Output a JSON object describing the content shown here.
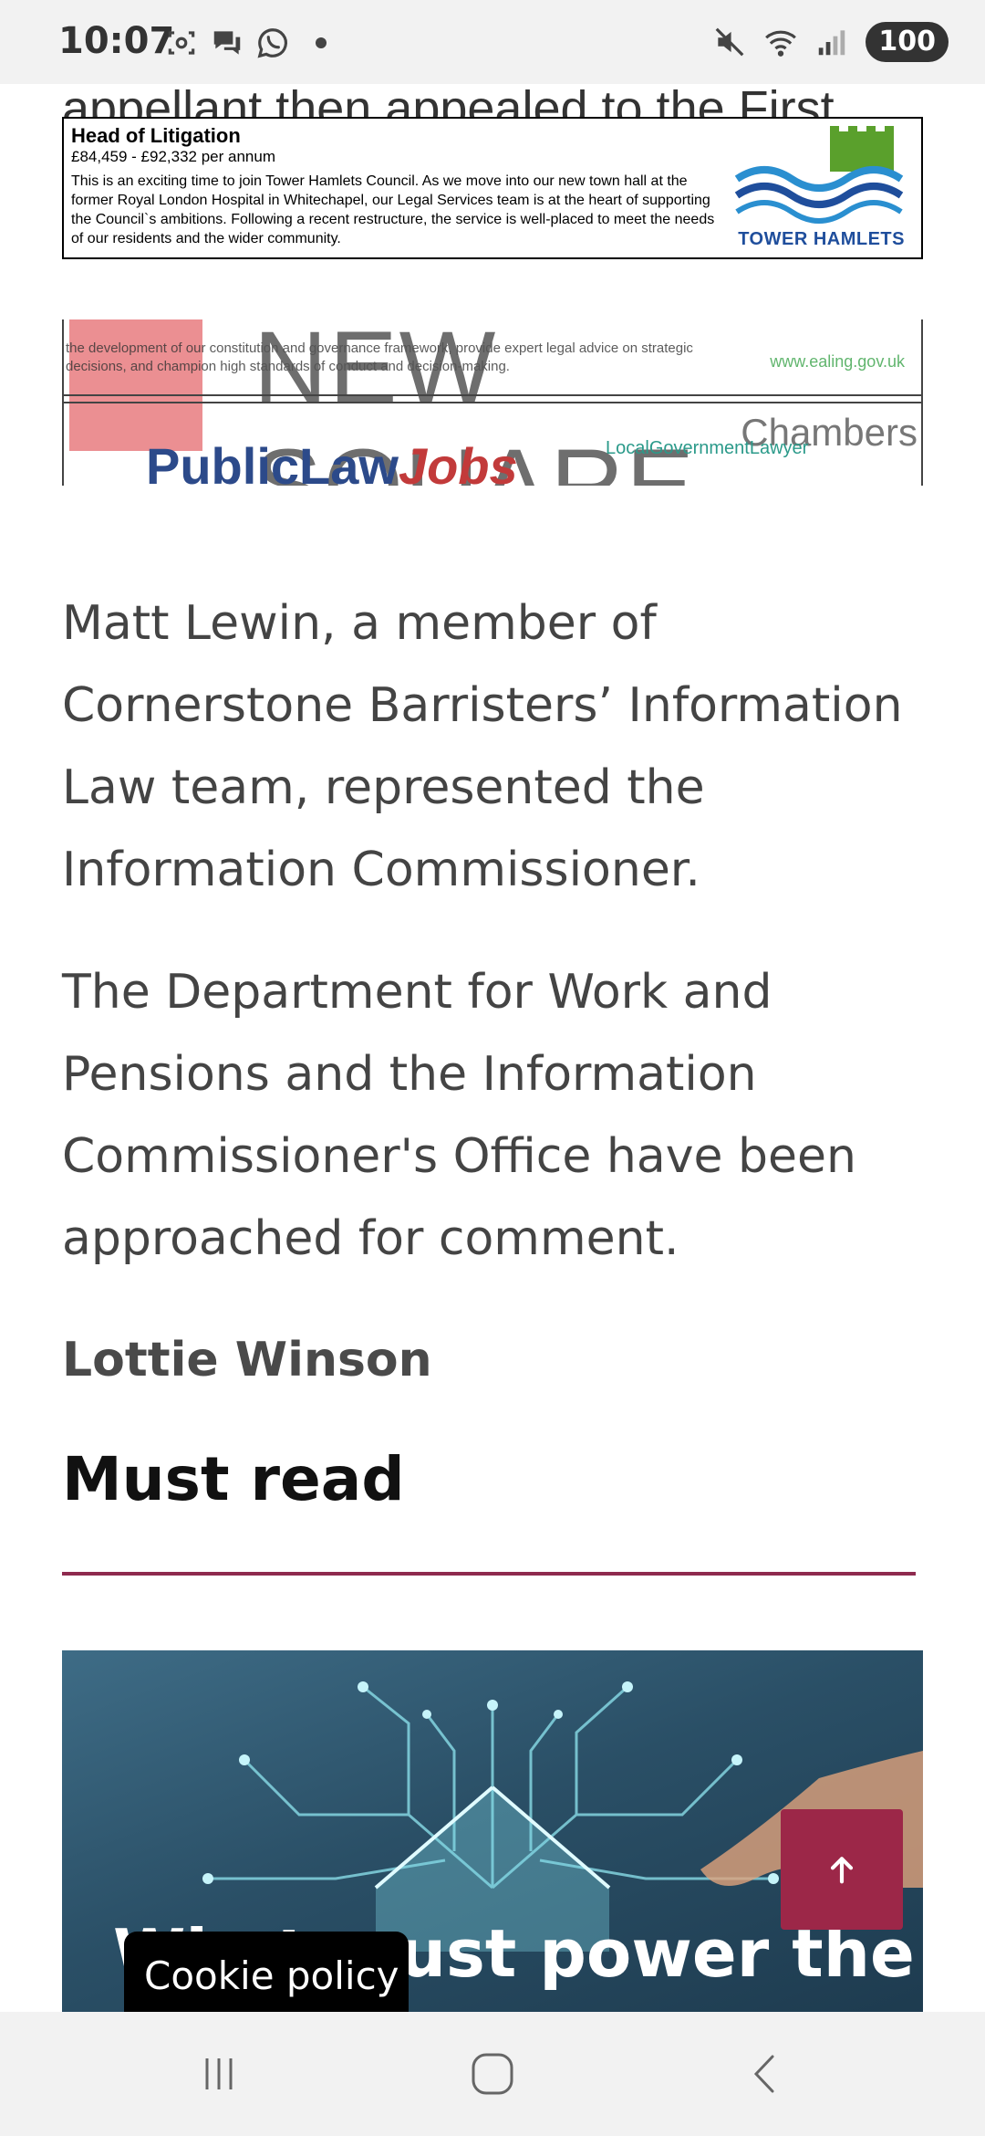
{
  "status_bar": {
    "time": "10:07",
    "battery": "100",
    "icons_left": [
      "screenshot-icon",
      "chat-icon",
      "whatsapp-icon",
      "notification-dot"
    ],
    "icons_right": [
      "mute-icon",
      "wifi-icon",
      "signal-icon"
    ]
  },
  "article": {
    "cut_line": "appellant then appealed to the First",
    "paragraph1": "Matt Lewin, a member of Cornerstone Barristers’ Information Law team, represented the Information Commissioner.",
    "paragraph2": "The Department for Work and Pensions and the Information Commissioner's Office have been approached for comment.",
    "author": "Lottie Winson"
  },
  "ad_tower_hamlets": {
    "title": "Head of Litigation",
    "salary": "£84,459 - £92,332 per annum",
    "body": "This is an exciting time to join Tower Hamlets Council. As we move into our new town hall at the former Royal London Hospital in Whitechapel, our Legal Services team is at the heart of supporting the Council`s ambitions. Following a recent restructure, the service is well-placed to meet the needs of our residents and the wider community.",
    "logo_text": "TOWER HAMLETS"
  },
  "ad_stack": {
    "new_square": "NEW SQUARE",
    "chambers": "Chambers",
    "faint_text": "the development of our constitution and governance framework, provide expert legal advice on strategic decisions, and champion high standards of conduct and decision-making.",
    "ealing": "www.ealing.gov.uk",
    "plj_main": "PublicLaw",
    "plj_jobs": "Jobs",
    "lgl": "LocalGovernmentLawyer"
  },
  "must_read": {
    "heading": "Must read",
    "hero_title": "What must power the",
    "accent_color": "#8e2a4e"
  },
  "overlays": {
    "cookie_label": "Cookie policy",
    "scroll_top_icon": "arrow-up-icon",
    "scroll_top_color": "#9c2748"
  },
  "nav_bar": {
    "buttons": [
      "recents-icon",
      "home-icon",
      "back-icon"
    ]
  }
}
